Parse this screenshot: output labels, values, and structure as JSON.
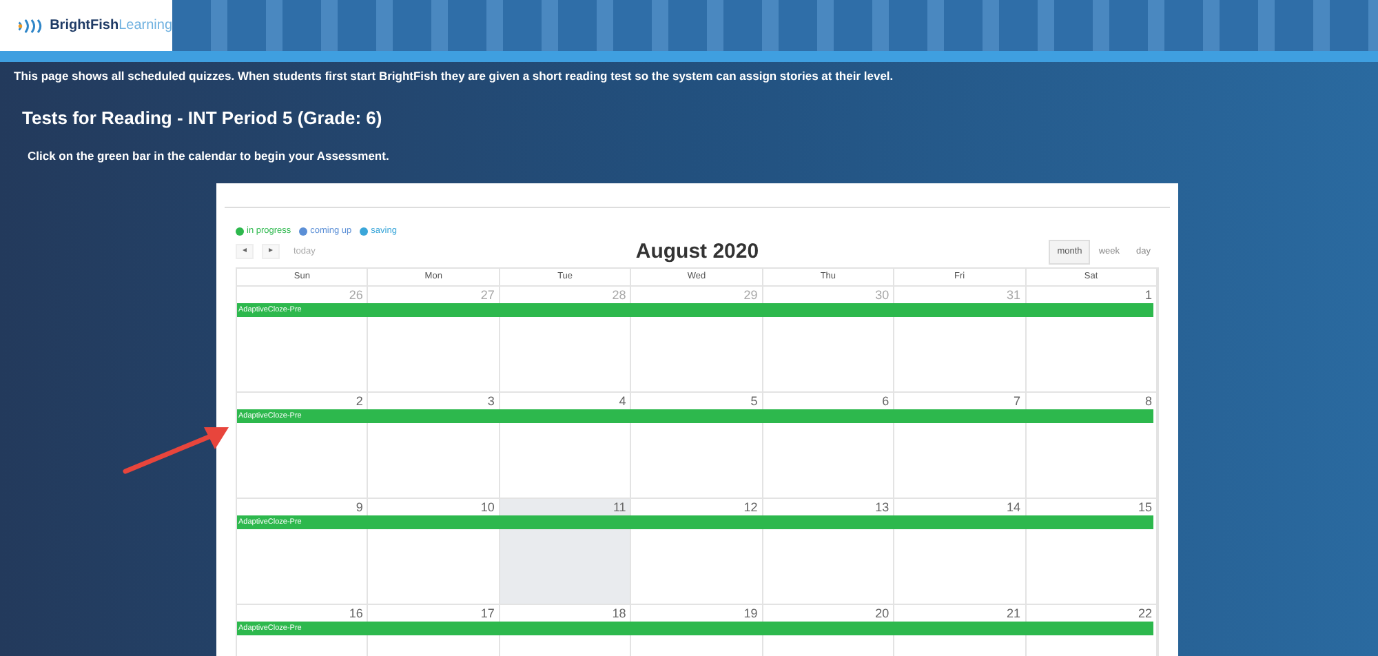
{
  "header": {
    "logo": {
      "brand": "BrightFish",
      "suffix": "Learning"
    }
  },
  "intro": "This page shows all scheduled quizzes. When students first start BrightFish they are given a short reading test so the system can assign stories at their level.",
  "title": "Tests for Reading - INT Period 5 (Grade: 6)",
  "instruction": "Click on the green bar in the calendar to begin your Assessment.",
  "calendar": {
    "legend": [
      {
        "label": "in progress",
        "color": "#2db84d"
      },
      {
        "label": "coming up",
        "color": "#5b8fd6"
      },
      {
        "label": "saving",
        "color": "#3aa6d9"
      }
    ],
    "nav": {
      "prev": "◂",
      "next": "▸",
      "today": "today"
    },
    "month_title": "August 2020",
    "views": [
      {
        "label": "month",
        "selected": true
      },
      {
        "label": "week",
        "selected": false
      },
      {
        "label": "day",
        "selected": false
      }
    ],
    "weekdays": [
      "Sun",
      "Mon",
      "Tue",
      "Wed",
      "Thu",
      "Fri",
      "Sat"
    ],
    "weeks": [
      {
        "days": [
          {
            "number": "26",
            "other_month": true,
            "today": false
          },
          {
            "number": "27",
            "other_month": true,
            "today": false
          },
          {
            "number": "28",
            "other_month": true,
            "today": false
          },
          {
            "number": "29",
            "other_month": true,
            "today": false
          },
          {
            "number": "30",
            "other_month": true,
            "today": false
          },
          {
            "number": "31",
            "other_month": true,
            "today": false
          },
          {
            "number": "1",
            "other_month": false,
            "today": false
          }
        ],
        "event": "AdaptiveCloze-Pre"
      },
      {
        "days": [
          {
            "number": "2",
            "other_month": false,
            "today": false
          },
          {
            "number": "3",
            "other_month": false,
            "today": false
          },
          {
            "number": "4",
            "other_month": false,
            "today": false
          },
          {
            "number": "5",
            "other_month": false,
            "today": false
          },
          {
            "number": "6",
            "other_month": false,
            "today": false
          },
          {
            "number": "7",
            "other_month": false,
            "today": false
          },
          {
            "number": "8",
            "other_month": false,
            "today": false
          }
        ],
        "event": "AdaptiveCloze-Pre"
      },
      {
        "days": [
          {
            "number": "9",
            "other_month": false,
            "today": false
          },
          {
            "number": "10",
            "other_month": false,
            "today": false
          },
          {
            "number": "11",
            "other_month": false,
            "today": true
          },
          {
            "number": "12",
            "other_month": false,
            "today": false
          },
          {
            "number": "13",
            "other_month": false,
            "today": false
          },
          {
            "number": "14",
            "other_month": false,
            "today": false
          },
          {
            "number": "15",
            "other_month": false,
            "today": false
          }
        ],
        "event": "AdaptiveCloze-Pre"
      },
      {
        "days": [
          {
            "number": "16",
            "other_month": false,
            "today": false
          },
          {
            "number": "17",
            "other_month": false,
            "today": false
          },
          {
            "number": "18",
            "other_month": false,
            "today": false
          },
          {
            "number": "19",
            "other_month": false,
            "today": false
          },
          {
            "number": "20",
            "other_month": false,
            "today": false
          },
          {
            "number": "21",
            "other_month": false,
            "today": false
          },
          {
            "number": "22",
            "other_month": false,
            "today": false
          }
        ],
        "event": "AdaptiveCloze-Pre"
      }
    ]
  }
}
